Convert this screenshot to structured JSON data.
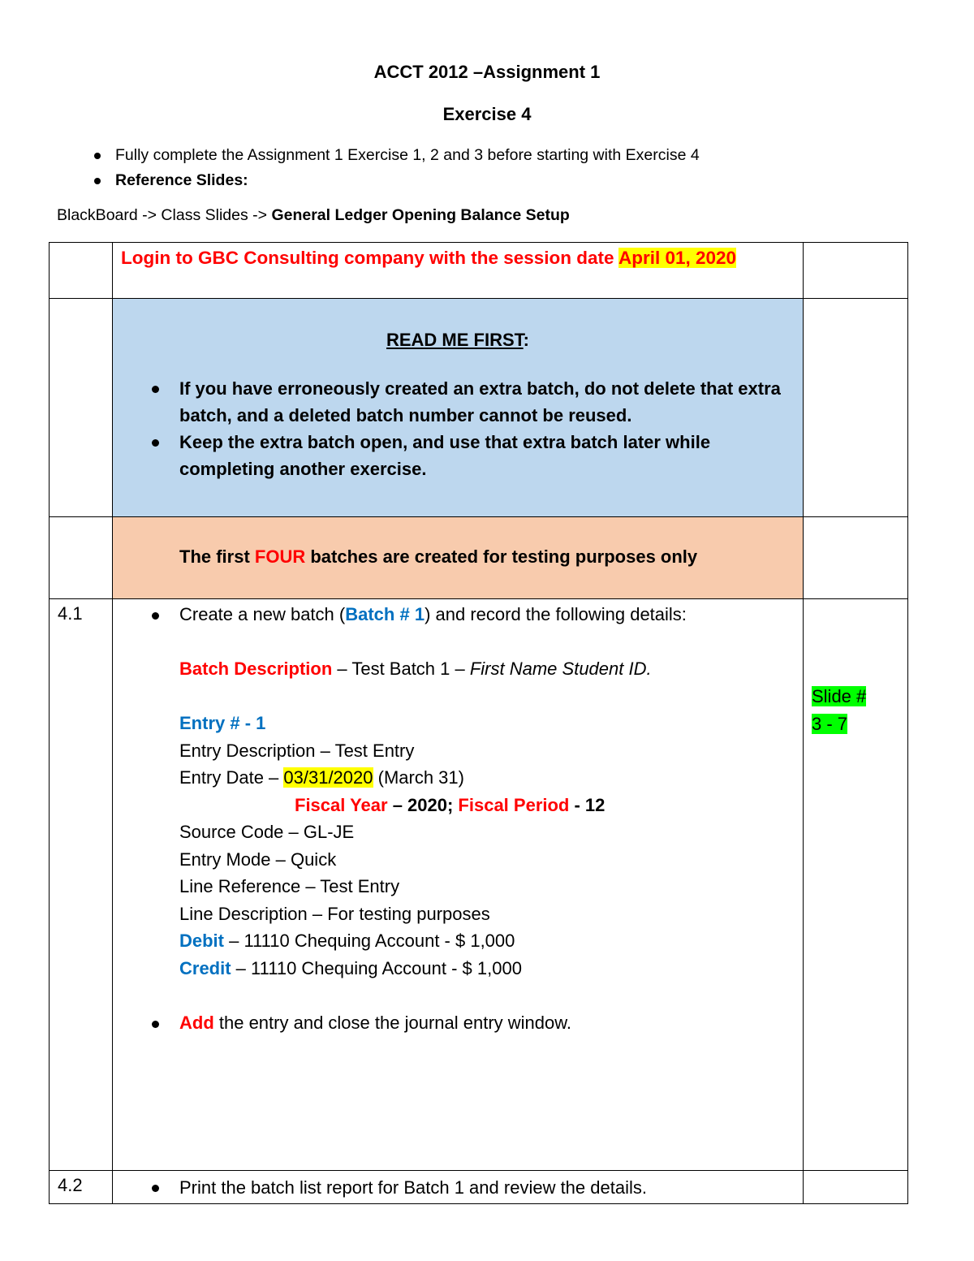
{
  "header": {
    "title": "ACCT 2012 –Assignment 1",
    "subtitle": "Exercise 4"
  },
  "intro": {
    "bullets": [
      "Fully complete the Assignment 1 Exercise 1, 2 and 3 before starting with Exercise 4",
      "Reference Slides:"
    ],
    "path_prefix": "BlackBoard -> Class Slides -> ",
    "path_bold": "General Ledger Opening Balance Setup"
  },
  "table": {
    "login_row": {
      "text": "Login to GBC Consulting company with the session date ",
      "date": "April 01, 2020"
    },
    "read_me_row": {
      "heading": "READ ME FIRST",
      "heading_suffix": ":",
      "bullets": [
        "If you have erroneously created an extra batch, do not delete that extra batch, and a deleted batch number cannot be reused.",
        "Keep the extra batch open, and use that extra batch later while completing another exercise."
      ]
    },
    "four_row": {
      "prefix": "The first ",
      "emphasis": "FOUR",
      "suffix": " batches are created for testing purposes only"
    },
    "step_4_1": {
      "number": "4.1",
      "create_prefix": "Create a new batch (",
      "create_batch": "Batch # 1",
      "create_suffix": ") and record the following details:",
      "batch_desc_label": "Batch Description",
      "batch_desc_value": " – Test Batch 1 – ",
      "batch_desc_italic": "First Name Student ID.",
      "entry_label": "Entry #  - 1",
      "entry_description": "Entry Description – Test Entry",
      "entry_date_prefix": "Entry Date – ",
      "entry_date": "03/31/2020",
      "entry_date_suffix": " (March 31)",
      "fiscal_year_label": "Fiscal Year",
      "fiscal_year_value": " – 2020; ",
      "fiscal_period_label": "Fiscal Period",
      "fiscal_period_value": " - 12",
      "source_code": "Source Code – GL-JE",
      "entry_mode": "Entry Mode – Quick",
      "line_reference": "Line Reference – Test Entry",
      "line_description": "Line Description – For testing purposes",
      "debit_label": "Debit",
      "debit_value": " – 11110 Chequing Account - $ 1,000",
      "credit_label": "Credit",
      "credit_value": " – 11110 Chequing Account - $ 1,000",
      "add_label": "Add",
      "add_suffix": " the entry and close the journal entry window.",
      "slide_ref_line1": "Slide #",
      "slide_ref_line2": "3 - 7"
    },
    "step_4_2": {
      "number": "4.2",
      "text": "Print the batch list report for Batch 1 and review the details."
    }
  },
  "colors": {
    "red": "#ff0000",
    "blue": "#0070c0",
    "yellow_highlight": "#ffff00",
    "green_highlight": "#00ff00",
    "read_me_bg": "#bdd7ee",
    "four_bg": "#f8cbad"
  }
}
